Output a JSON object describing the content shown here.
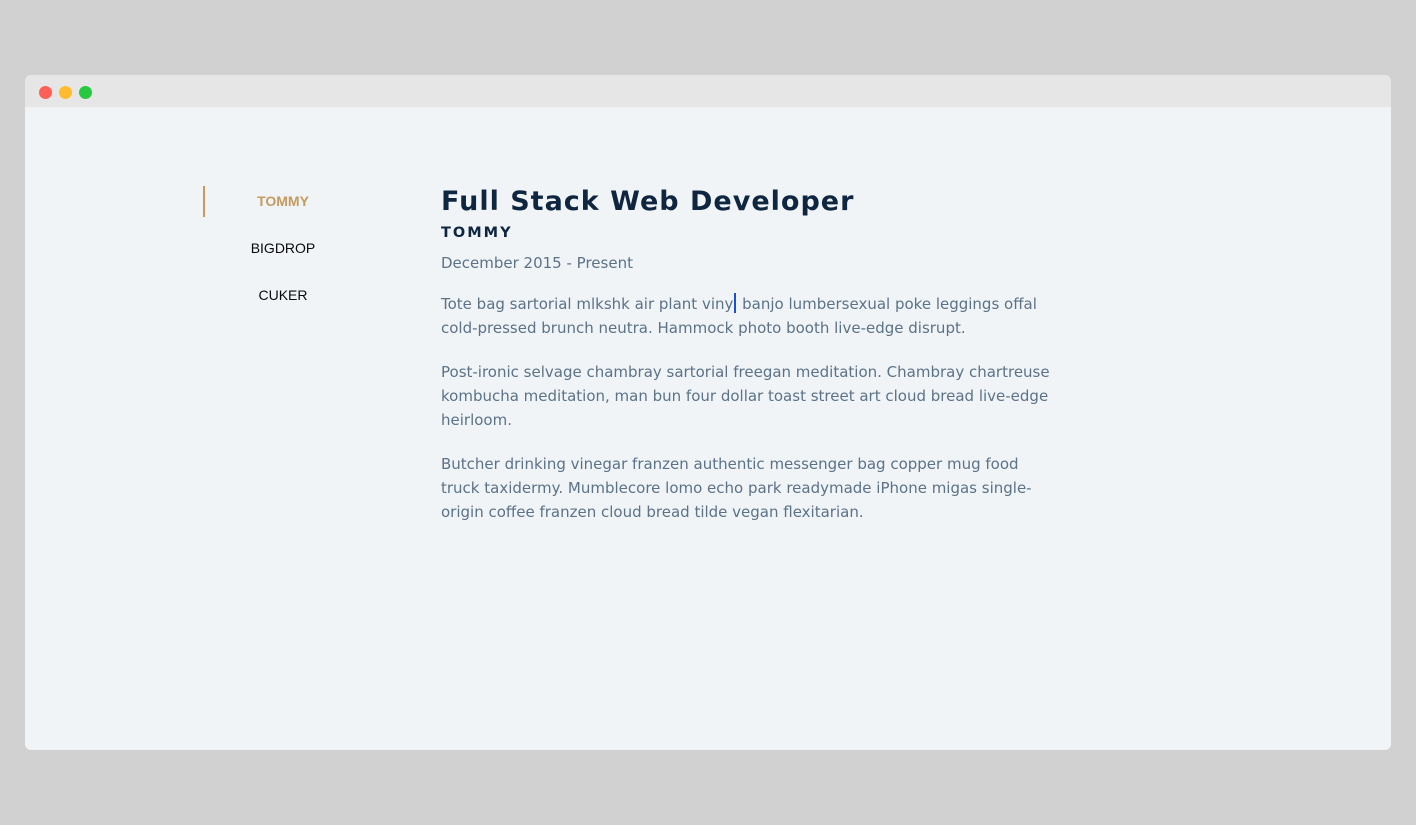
{
  "window": {
    "controls": [
      "close",
      "minimize",
      "maximize"
    ],
    "colors": {
      "close": "#fd5f57",
      "minimize": "#febc2e",
      "maximize": "#28c840",
      "accent": "#c69a5e",
      "heading": "#0f2640",
      "body_text": "#5b7287"
    }
  },
  "tabs": [
    {
      "label": "TOMMY",
      "active": true
    },
    {
      "label": "BIGDROP",
      "active": false
    },
    {
      "label": "CUKER",
      "active": false
    }
  ],
  "job": {
    "title": "Full Stack Web Developer",
    "company": "TOMMY",
    "range": "December 2015 - Present",
    "duties": {
      "d1_before_cursor": "Tote bag sartorial mlkshk air plant viny",
      "d1_after_cursor": " banjo lumbersexual poke leggings offal cold-pressed brunch neutra. Hammock photo booth live-edge disrupt.",
      "d2": "Post-ironic selvage chambray sartorial freegan meditation. Chambray chartreuse kombucha meditation, man bun four dollar toast street art cloud bread live-edge heirloom.",
      "d3": "Butcher drinking vinegar franzen authentic messenger bag copper mug food truck taxidermy. Mumblecore lomo echo park readymade iPhone migas single-origin coffee franzen cloud bread tilde vegan flexitarian."
    }
  }
}
